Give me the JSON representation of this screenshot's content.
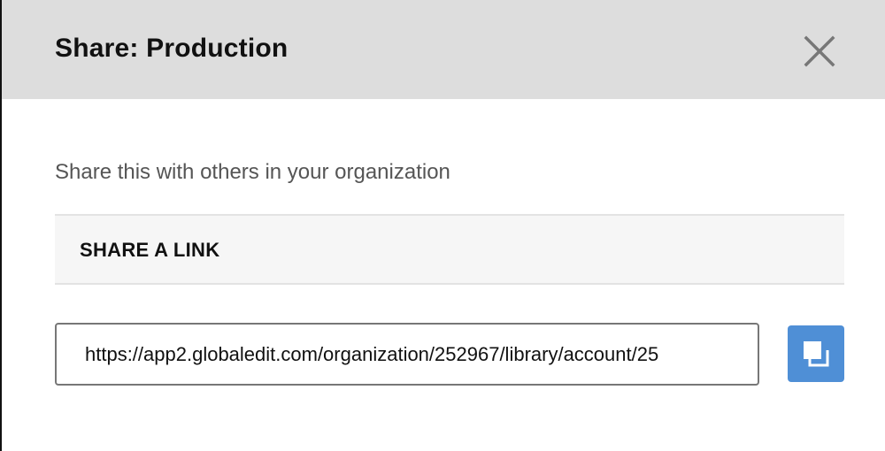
{
  "modal": {
    "title": "Share: Production",
    "subtitle": "Share this with others in your organization",
    "close_icon": "close-icon"
  },
  "share_link": {
    "section_title": "SHARE A LINK",
    "url": "https://app2.globaledit.com/organization/252967/library/account/25",
    "copy_icon": "copy-icon"
  },
  "colors": {
    "header_bg": "#dddddd",
    "section_bg": "#f6f6f6",
    "copy_button_bg": "#4f8fd6",
    "text_primary": "#111111",
    "text_secondary": "#555555"
  }
}
